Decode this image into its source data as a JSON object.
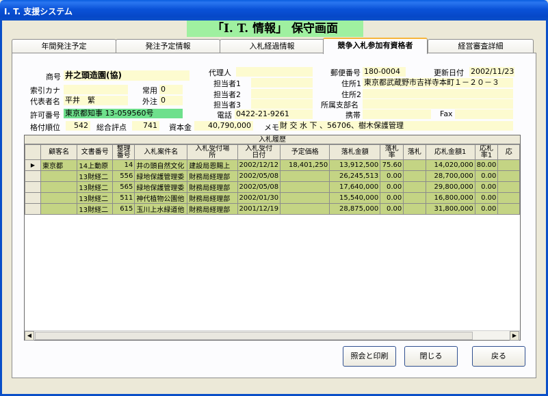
{
  "window": {
    "title": "I. T. 支援システム"
  },
  "heading": "「I. T. 情報」 保守画面",
  "tabs": [
    "年間発注予定",
    "発注予定情報",
    "入札経過情報",
    "競争入札参加有資格者",
    "経営審査詳細"
  ],
  "form": {
    "shogo_label": "商号",
    "shogo": "井之頭造園(協)",
    "update_label": "更新日付",
    "update_date": "2002/11/23",
    "agent_label": "代理人",
    "agent": "",
    "postal_label": "郵便番号",
    "postal": "180-0004",
    "kana_label": "索引カナ",
    "kana": "",
    "jouyou_label": "常用",
    "jouyou": "0",
    "tanto1_label": "担当者1",
    "tanto1": "",
    "addr1_label": "住所1",
    "addr1": "東京都武蔵野市吉祥寺本町１－２０－３",
    "rep_label": "代表者名",
    "rep": "平井　繁",
    "gaichu_label": "外注",
    "gaichu": "0",
    "tanto2_label": "担当者2",
    "tanto2": "",
    "addr2_label": "住所2",
    "addr2": "",
    "tanto3_label": "担当者3",
    "tanto3": "",
    "branch_label": "所属支部名",
    "branch": "",
    "license_label": "許可番号",
    "license": "東京都知事 13-059560号",
    "phone_label": "電話",
    "phone": "0422-21-9261",
    "mobile_label": "携帯",
    "mobile": "",
    "fax_label": "Fax",
    "fax": "",
    "rank_label": "格付順位",
    "rank": "542",
    "score_label": "総合評点",
    "score": "741",
    "capital_label": "資本金",
    "capital": "40,790,000",
    "memo_label": "メモ",
    "memo": "財 交 水 下 、56706、樹木保護管理"
  },
  "grid": {
    "title": "入札履歴",
    "columns": [
      "顧客名",
      "文書番号",
      "整理\n番号",
      "入札案件名",
      "入札受付場\n所",
      "入札受付\n日付",
      "予定価格",
      "落札金額",
      "落札\n率",
      "落札",
      "応札金額1",
      "応札\n率1",
      "応"
    ],
    "rows": [
      [
        "東京都",
        "14上動原",
        "14",
        "井の頭自然文化",
        "建設局恩賜上",
        "2002/12/12",
        "18,401,250",
        "13,912,500",
        "75.60",
        "",
        "14,020,000",
        "80.00",
        ""
      ],
      [
        "",
        "13財経二",
        "556",
        "緑地保護管理委",
        "財務局経理部",
        "2002/05/08",
        "",
        "26,245,513",
        "0.00",
        "",
        "28,700,000",
        "0.00",
        ""
      ],
      [
        "",
        "13財経二",
        "565",
        "緑地保護管理委",
        "財務局経理部",
        "2002/05/08",
        "",
        "17,640,000",
        "0.00",
        "",
        "29,800,000",
        "0.00",
        ""
      ],
      [
        "",
        "13財経二",
        "511",
        "神代植物公園他",
        "財務局経理部",
        "2002/01/30",
        "",
        "15,540,000",
        "0.00",
        "",
        "16,800,000",
        "0.00",
        ""
      ],
      [
        "",
        "13財経二",
        "615",
        "玉川上水緑道他",
        "財務局経理部",
        "2001/12/19",
        "",
        "28,875,000",
        "0.00",
        "",
        "31,800,000",
        "0.00",
        ""
      ]
    ]
  },
  "buttons": {
    "inquiry": "照会と印刷",
    "close": "閉じる",
    "back": "戻る"
  }
}
